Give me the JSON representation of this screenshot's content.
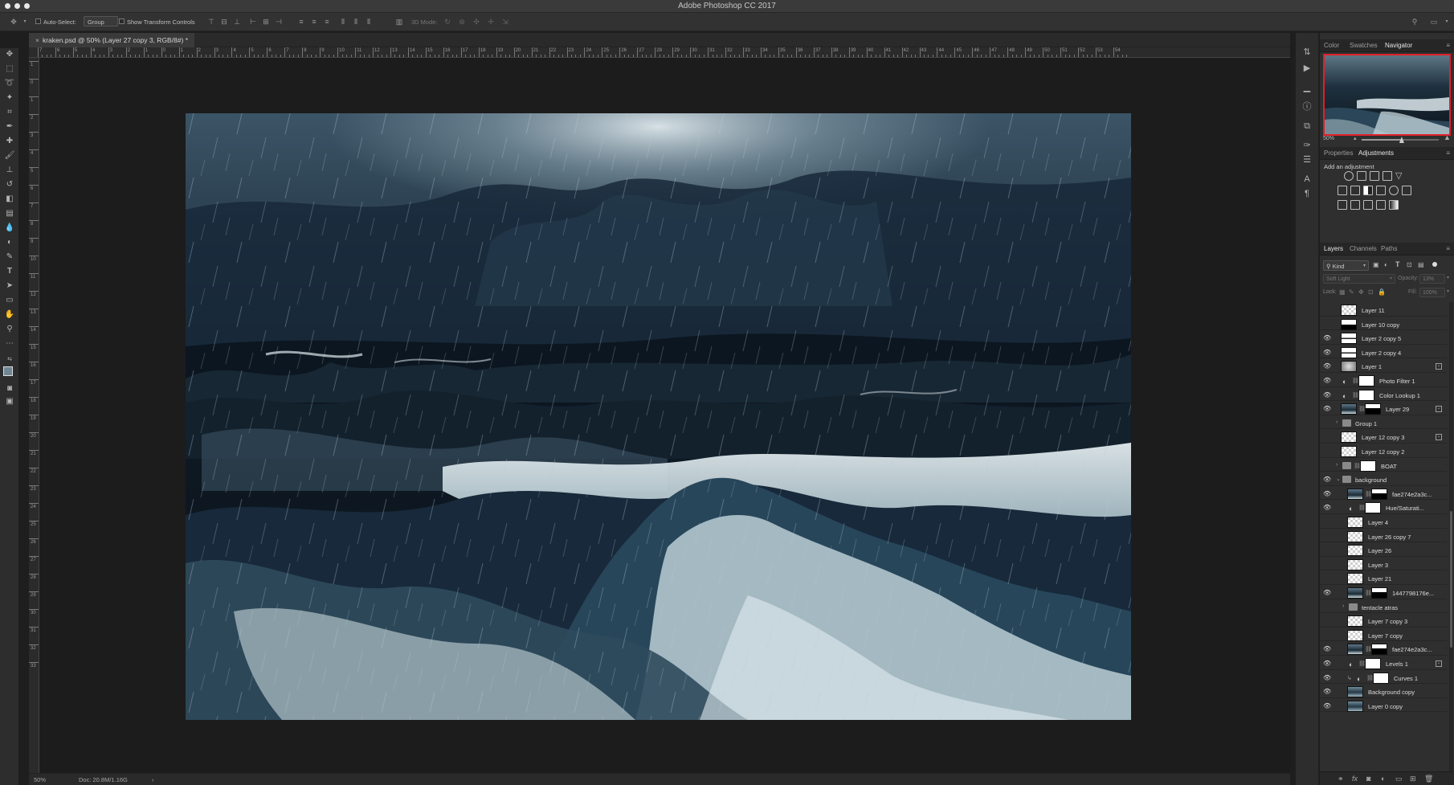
{
  "app": {
    "title": "Adobe Photoshop CC 2017"
  },
  "options_bar": {
    "auto_select_label": "Auto-Select:",
    "auto_select_value": "Group",
    "show_transform_controls_label": "Show Transform Controls",
    "mode_3d_label": "3D Mode:"
  },
  "document": {
    "tab_label": "kraken.psd @ 50% (Layer 27 copy 3, RGB/8#) *"
  },
  "rulers": {
    "horizontal": [
      "7",
      "6",
      "5",
      "4",
      "3",
      "2",
      "1",
      "0",
      "1",
      "2",
      "3",
      "4",
      "5",
      "6",
      "7",
      "8",
      "9",
      "10",
      "11",
      "12",
      "13",
      "14",
      "15",
      "16",
      "17",
      "18",
      "19",
      "20",
      "21",
      "22",
      "23",
      "24",
      "25",
      "26",
      "27",
      "28",
      "29",
      "30",
      "31",
      "32",
      "33",
      "34",
      "35",
      "36",
      "37",
      "38",
      "39",
      "40",
      "41",
      "42",
      "43",
      "44",
      "45",
      "46",
      "47",
      "48",
      "49",
      "50",
      "51",
      "52",
      "53",
      "54"
    ],
    "vertical": [
      "1",
      "0",
      "1",
      "2",
      "3",
      "4",
      "5",
      "6",
      "7",
      "8",
      "9",
      "10",
      "11",
      "12",
      "13",
      "14",
      "15",
      "16",
      "17",
      "18",
      "19",
      "20",
      "21",
      "22",
      "23",
      "24",
      "25",
      "26",
      "27",
      "28",
      "29",
      "30",
      "31",
      "32",
      "33"
    ]
  },
  "status": {
    "zoom": "50%",
    "doc": "Doc: 20.8M/1.16G"
  },
  "navigator": {
    "tabs": [
      "Color",
      "Swatches",
      "Navigator"
    ],
    "active_tab": "Navigator",
    "zoom": "50%",
    "zoom_level": 0.52
  },
  "adjustments": {
    "tabs": [
      "Properties",
      "Adjustments"
    ],
    "active_tab": "Adjustments",
    "heading": "Add an adjustment"
  },
  "layers_panel": {
    "tabs": [
      "Layers",
      "Channels",
      "Paths"
    ],
    "active_tab": "Layers",
    "filter_kind": "Kind",
    "blend_mode": "Soft Light",
    "opacity_label": "Opacity:",
    "opacity_value": "13%",
    "lock_label": "Lock:",
    "fill_label": "Fill:",
    "fill_value": "100%",
    "layers": [
      {
        "name": "Layer 11",
        "visible": false,
        "indent": 0,
        "kind": "pixel"
      },
      {
        "name": "Layer 10 copy",
        "visible": false,
        "indent": 0,
        "kind": "pixel-dark"
      },
      {
        "name": "Layer 2 copy 5",
        "visible": true,
        "indent": 0,
        "kind": "pixel-wave"
      },
      {
        "name": "Layer 2 copy 4",
        "visible": true,
        "indent": 0,
        "kind": "pixel-wave"
      },
      {
        "name": "Layer 1",
        "visible": true,
        "indent": 0,
        "kind": "pixel-grad",
        "fx": true
      },
      {
        "name": "Photo Filter 1",
        "visible": true,
        "indent": 0,
        "kind": "adjust"
      },
      {
        "name": "Color Lookup 1",
        "visible": true,
        "indent": 0,
        "kind": "adjust"
      },
      {
        "name": "Layer 29",
        "visible": true,
        "indent": 0,
        "kind": "masked",
        "fx": true
      },
      {
        "name": "Group 1",
        "visible": false,
        "indent": 0,
        "kind": "group"
      },
      {
        "name": "Layer 12 copy 3",
        "visible": false,
        "indent": 0,
        "kind": "pixel",
        "fx": true
      },
      {
        "name": "Layer 12 copy 2",
        "visible": false,
        "indent": 0,
        "kind": "pixel"
      },
      {
        "name": "BOAT",
        "visible": false,
        "indent": 0,
        "kind": "group-mask"
      },
      {
        "name": "background",
        "visible": true,
        "indent": 0,
        "kind": "group-open"
      },
      {
        "name": "fae274e2a3c...",
        "visible": true,
        "indent": 1,
        "kind": "masked"
      },
      {
        "name": "Hue/Saturati...",
        "visible": true,
        "indent": 1,
        "kind": "adjust"
      },
      {
        "name": "Layer 4",
        "visible": false,
        "indent": 1,
        "kind": "pixel"
      },
      {
        "name": "Layer 26 copy 7",
        "visible": false,
        "indent": 1,
        "kind": "pixel"
      },
      {
        "name": "Layer 26",
        "visible": false,
        "indent": 1,
        "kind": "pixel"
      },
      {
        "name": "Layer 3",
        "visible": false,
        "indent": 1,
        "kind": "pixel"
      },
      {
        "name": "Layer 21",
        "visible": false,
        "indent": 1,
        "kind": "pixel"
      },
      {
        "name": "1447798176e...",
        "visible": true,
        "indent": 1,
        "kind": "masked"
      },
      {
        "name": "tentacle atras",
        "visible": false,
        "indent": 1,
        "kind": "group"
      },
      {
        "name": "Layer 7 copy 3",
        "visible": false,
        "indent": 1,
        "kind": "pixel"
      },
      {
        "name": "Layer 7 copy",
        "visible": false,
        "indent": 1,
        "kind": "pixel"
      },
      {
        "name": "fae274e2a3c...",
        "visible": true,
        "indent": 1,
        "kind": "masked"
      },
      {
        "name": "Levels 1",
        "visible": true,
        "indent": 1,
        "kind": "adjust",
        "fx": true
      },
      {
        "name": "Curves 1",
        "visible": true,
        "indent": 1,
        "kind": "adjust-clip"
      },
      {
        "name": "Background copy",
        "visible": true,
        "indent": 1,
        "kind": "photo"
      },
      {
        "name": "Layer 0 copy",
        "visible": true,
        "indent": 1,
        "kind": "photo"
      }
    ]
  },
  "colors": {
    "accent_navigator_frame": "#e0202a",
    "panel_bg": "#2f2f2f",
    "canvas_bg": "#1c1c1c",
    "sea_dark": "#0e1822",
    "foam": "#dfe8ec"
  }
}
